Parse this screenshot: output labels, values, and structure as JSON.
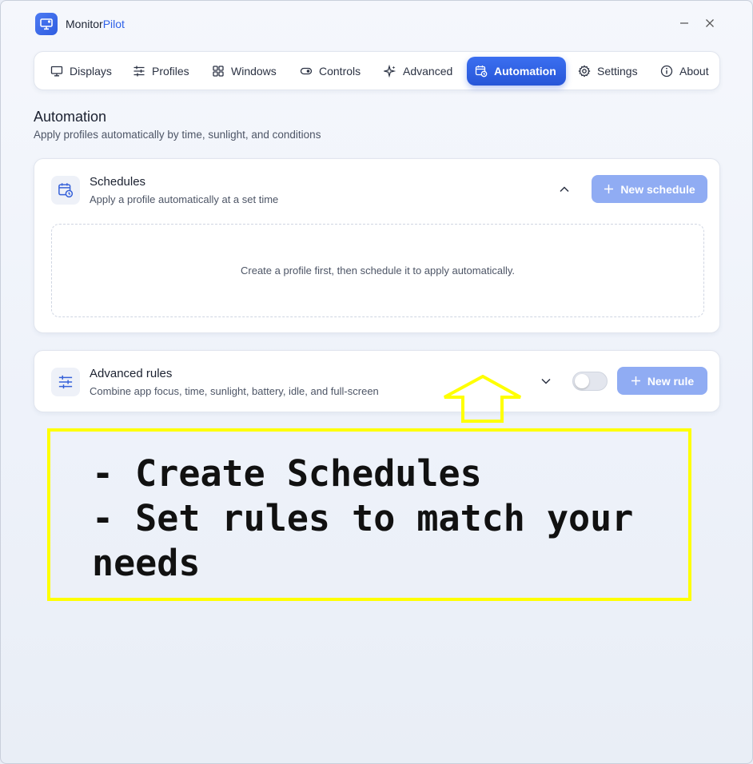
{
  "app": {
    "title_main": "Monitor",
    "title_accent": "Pilot",
    "logo_icon": "monitor-settings-icon"
  },
  "window_controls": {
    "minimize_icon": "minimize-icon",
    "close_icon": "close-icon"
  },
  "tabs": [
    {
      "label": "Displays",
      "icon": "monitor-icon",
      "active": false
    },
    {
      "label": "Profiles",
      "icon": "sliders-icon",
      "active": false
    },
    {
      "label": "Windows",
      "icon": "grid-icon",
      "active": false
    },
    {
      "label": "Controls",
      "icon": "toggle-icon",
      "active": false
    },
    {
      "label": "Advanced",
      "icon": "sparkle-icon",
      "active": false
    },
    {
      "label": "Automation",
      "icon": "calendar-clock-icon",
      "active": true
    },
    {
      "label": "Settings",
      "icon": "gear-icon",
      "active": false
    },
    {
      "label": "About",
      "icon": "info-icon",
      "active": false
    }
  ],
  "page": {
    "title": "Automation",
    "subtitle": "Apply profiles automatically by time, sunlight, and conditions"
  },
  "schedules": {
    "title": "Schedules",
    "subtitle": "Apply a profile automatically at a set time",
    "expanded": true,
    "new_button": "New schedule",
    "empty_message": "Create a profile first, then schedule it to apply automatically."
  },
  "rules": {
    "title": "Advanced rules",
    "subtitle": "Combine app focus, time, sunlight, battery, idle, and full-screen",
    "expanded": false,
    "enabled": false,
    "new_button": "New rule"
  },
  "annotation": {
    "lines": [
      "- Create Schedules",
      "- Set rules to match your",
      "needs"
    ],
    "border_color": "#ffff00",
    "arrow_color": "#ffff00"
  },
  "colors": {
    "accent": "#2f62e8",
    "button_disabled": "#90acf3"
  }
}
